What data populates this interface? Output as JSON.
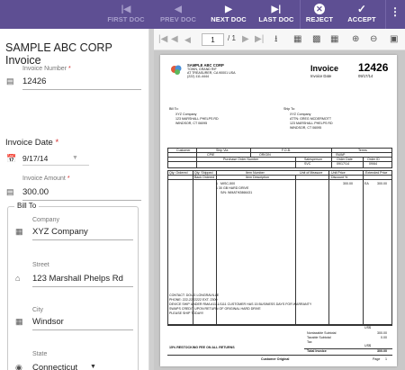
{
  "toolbar": {
    "first_doc": "FIRST DOC",
    "prev_doc": "PREV DOC",
    "next_doc": "NEXT DOC",
    "last_doc": "LAST DOC",
    "reject": "REJECT",
    "accept": "ACCEPT",
    "more_icon": "more-vert-icon",
    "accent_color": "#5e4f93"
  },
  "form": {
    "title": "SAMPLE ABC CORP Invoice",
    "invoice_number": {
      "label": "Invoice Number",
      "value": "12426"
    },
    "invoice_date": {
      "label": "Invoice Date",
      "value": "9/17/14"
    },
    "invoice_amount": {
      "label": "Invoice Amount",
      "value": "300.00"
    },
    "bill_to": {
      "title": "Bill To",
      "company": {
        "label": "Company",
        "value": "XYZ Company"
      },
      "street": {
        "label": "Street",
        "value": "123 Marshall Phelps Rd"
      },
      "city": {
        "label": "City",
        "value": "Windsor"
      },
      "state": {
        "label": "State",
        "value": "Connecticut"
      }
    }
  },
  "viewer": {
    "current_page": "1",
    "page_total": "/ 1"
  },
  "document": {
    "company_name": "SAMPLE ABC CORP",
    "company_addr1": "TOWN, GRAND RIF",
    "company_addr2": "AT TREASURER, CA 90001 USA",
    "company_phone": "(222) 111-4444",
    "invoice_title": "Invoice",
    "invoice_number": "12426",
    "invoice_date_label": "Invoice Date",
    "invoice_date": "09/17/14",
    "bill_to_label": "Bill To:",
    "bill_to_lines": [
      "XYZ Company",
      "123 MARSHALL PHELPS RD",
      "WINDSOR, CT 06095"
    ],
    "ship_to_label": "Ship To:",
    "ship_to_lines": [
      "XYZ Company",
      "ATTN: GREG MCDERMOTT",
      "123 MARSHALL PHELPS RD",
      "WINDSOR, CT 06095"
    ],
    "hdr_row1": [
      "Customer",
      "Ship Via",
      "F.O.B.",
      "Terms"
    ],
    "hdr_row1_vals": [
      "CPIE",
      "ORIGIN",
      "SWAP"
    ],
    "hdr_row2": [
      "Purchase Order Number",
      "Salesperson",
      "Order Date",
      "Order ID"
    ],
    "hdr_row2_vals": [
      "SVC",
      "09/17/14",
      "09/64"
    ],
    "item_hdr": [
      "Qty. Ordered",
      "Qty. Shipped",
      "Back Ordered",
      "Item Number",
      "Item Description",
      "Unit of Measure",
      "Unit Price",
      "Discount %",
      "Extended Price"
    ],
    "item_lines": [
      "1",
      "MISC-500",
      "1 30 GB HARD DRIVE",
      "S/N: WMATH2866431"
    ],
    "item_price": "300.00",
    "item_ext": "300.00",
    "item_uom": "EA",
    "footer_contact": "CONTACT: DOUG LONGRAVILLE",
    "footer_phone": "PHONE: 222-2222222 EXT. 2300",
    "footer_notes": [
      "DEVICE SHIP UNDER RMA #1111/1111 CUSTOMER HAS 15 BUSINESS DAYS FOR WARRANTY",
      "SWAPS CREDIT UPON RETURN OF ORIGINAL HARD DRIVE",
      "PLEASE SHIP TODAY!!"
    ],
    "restocking": "15% RESTOCKING FEE ON ALL RETURNS",
    "subtotal_label": "Nontaxable Subtotal",
    "taxable_label": "Taxable Subtotal",
    "tax_label": "Tax",
    "total_label": "Total Invoice",
    "currency": "US$",
    "subtotal": "300.00",
    "taxable": "0.00",
    "total": "300.00",
    "customer_original": "Customer Original",
    "page_label": "Page",
    "page_num": "1"
  }
}
